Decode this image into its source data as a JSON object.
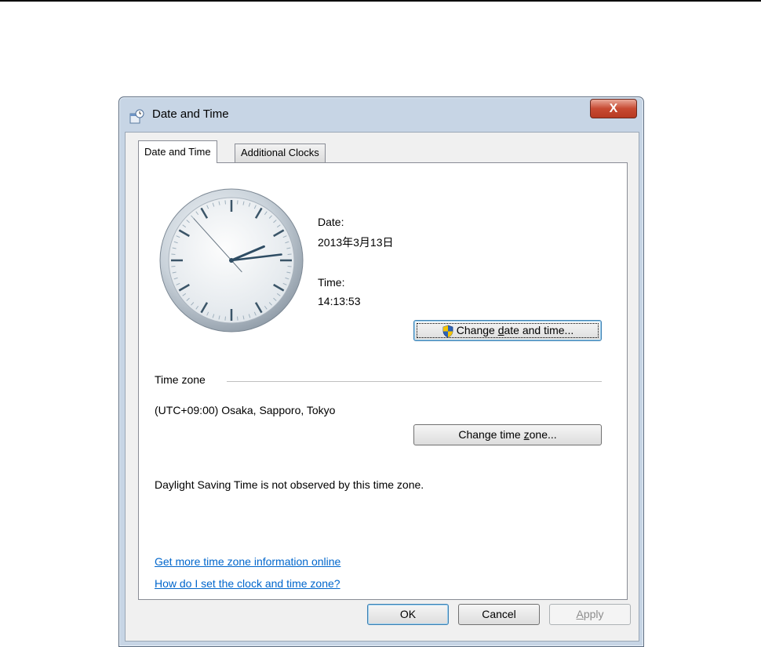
{
  "window": {
    "title": "Date and Time",
    "close_label": "X"
  },
  "tabs": [
    {
      "label": "Date and Time",
      "active": true
    },
    {
      "label": "Additional Clocks",
      "active": false
    }
  ],
  "date_time": {
    "date_label": "Date:",
    "date_value": "2013年3月13日",
    "time_label": "Time:",
    "time_value": "14:13:53",
    "change_button": {
      "pre": "Change ",
      "accel": "d",
      "post": "ate and time..."
    }
  },
  "clock": {
    "hour": 14,
    "minute": 13,
    "second": 53
  },
  "time_zone": {
    "section_label": "Time zone",
    "value": "(UTC+09:00) Osaka, Sapporo, Tokyo",
    "change_button": {
      "pre": "Change time ",
      "accel": "z",
      "post": "one..."
    },
    "dst_note": "Daylight Saving Time is not observed by this time zone."
  },
  "links": {
    "more_info": "Get more time zone information online",
    "how_to": "How do I set the clock and time zone?"
  },
  "footer": {
    "ok": "OK",
    "cancel": "Cancel",
    "apply": {
      "accel": "A",
      "rest": "pply"
    }
  },
  "colors": {
    "link": "#0066cc",
    "close_button": "#c74a32",
    "accent_border": "#3c7fb1"
  }
}
